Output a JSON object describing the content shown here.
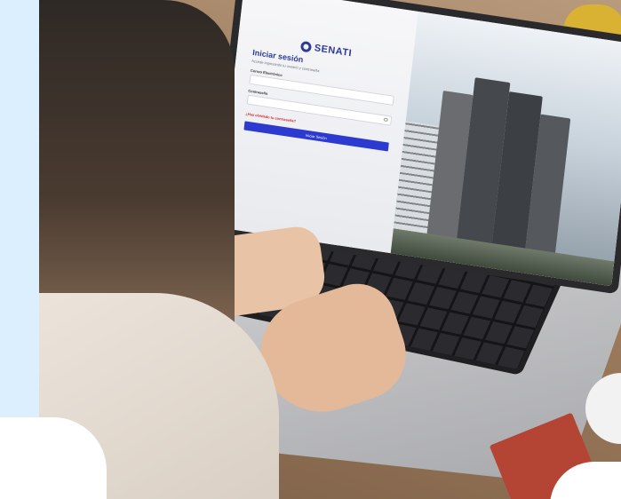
{
  "screen": {
    "brand_name": "SENATI",
    "title": "Iniciar sesión",
    "subtitle": "Accede ingresando tu usuario y contraseña",
    "email_label": "Correo Electrónico",
    "password_label": "Contraseña",
    "forgot_link": "¿Has olvidado tu contraseña?",
    "submit_button": "Iniciar Sesión"
  },
  "colors": {
    "accent_panel": "#dcefff",
    "brand": "#2d3a97",
    "button": "#2d3ad0",
    "link": "#d8222a"
  }
}
